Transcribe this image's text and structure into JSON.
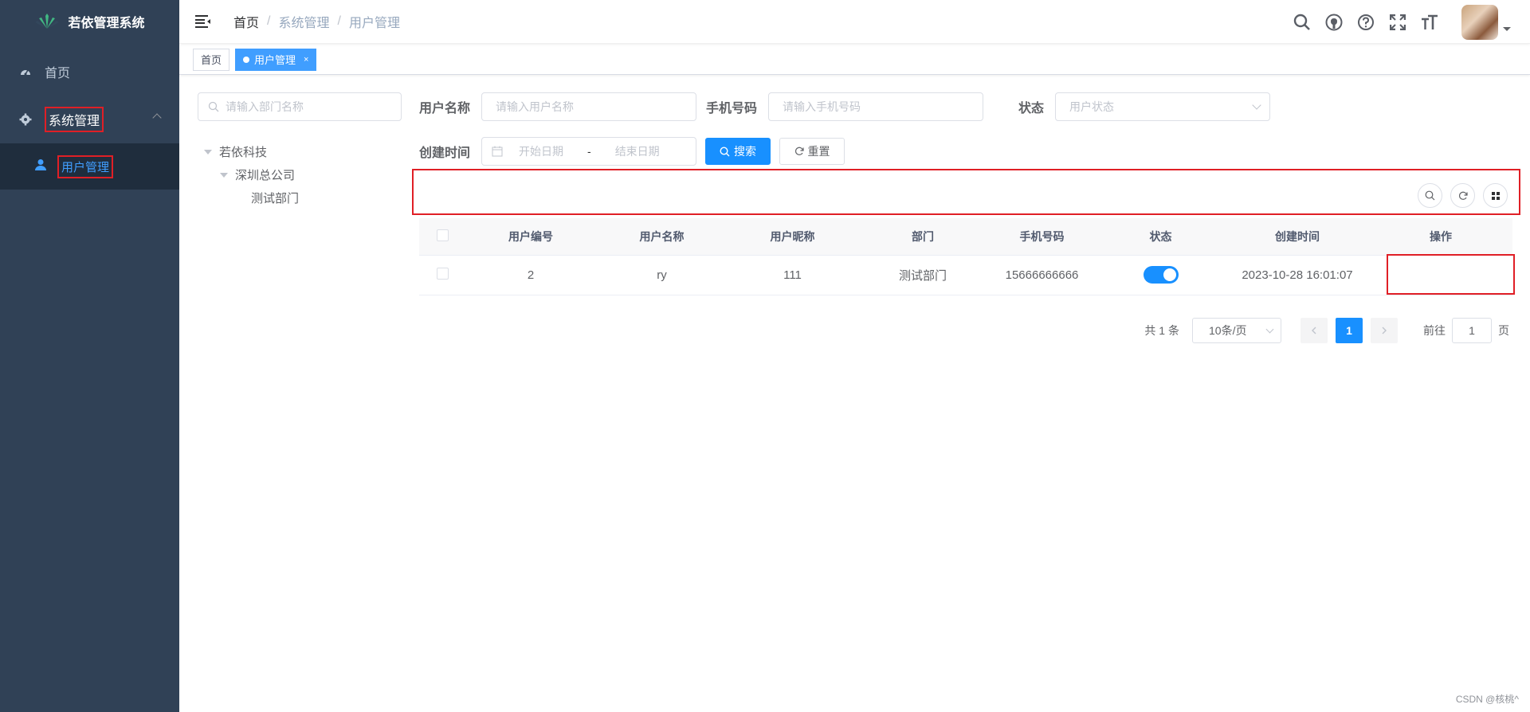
{
  "app": {
    "title": "若依管理系统"
  },
  "sidebar": {
    "items": [
      {
        "label": "首页",
        "icon": "dashboard-icon"
      },
      {
        "label": "系统管理",
        "icon": "gear-icon"
      }
    ],
    "sub_items": [
      {
        "label": "用户管理",
        "icon": "user-icon"
      }
    ]
  },
  "breadcrumb": [
    "首页",
    "系统管理",
    "用户管理"
  ],
  "tags": [
    {
      "label": "首页",
      "active": false
    },
    {
      "label": "用户管理",
      "active": true,
      "close": "×"
    }
  ],
  "dept": {
    "placeholder": "请输入部门名称",
    "tree": [
      "若依科技",
      "深圳总公司",
      "测试部门"
    ]
  },
  "search": {
    "username_label": "用户名称",
    "username_placeholder": "请输入用户名称",
    "phone_label": "手机号码",
    "phone_placeholder": "请输入手机号码",
    "status_label": "状态",
    "status_placeholder": "用户状态",
    "created_label": "创建时间",
    "start_placeholder": "开始日期",
    "range_sep": "-",
    "end_placeholder": "结束日期",
    "search_button": "搜索",
    "reset_button": "重置"
  },
  "table": {
    "headers": [
      "用户编号",
      "用户名称",
      "用户昵称",
      "部门",
      "手机号码",
      "状态",
      "创建时间",
      "操作"
    ],
    "rows": [
      {
        "id": "2",
        "username": "ry",
        "nickname": "111",
        "dept": "测试部门",
        "phone": "15666666666",
        "status_on": true,
        "created": "2023-10-28 16:01:07"
      }
    ]
  },
  "pagination": {
    "total": "共 1 条",
    "page_size": "10条/页",
    "current_page": "1",
    "goto_label": "前往",
    "goto_value": "1",
    "page_suffix": "页"
  },
  "watermark": "CSDN @核桃^",
  "colors": {
    "sidebar": "#304156",
    "accent": "#1890ff",
    "highlight": "#e01f26"
  }
}
